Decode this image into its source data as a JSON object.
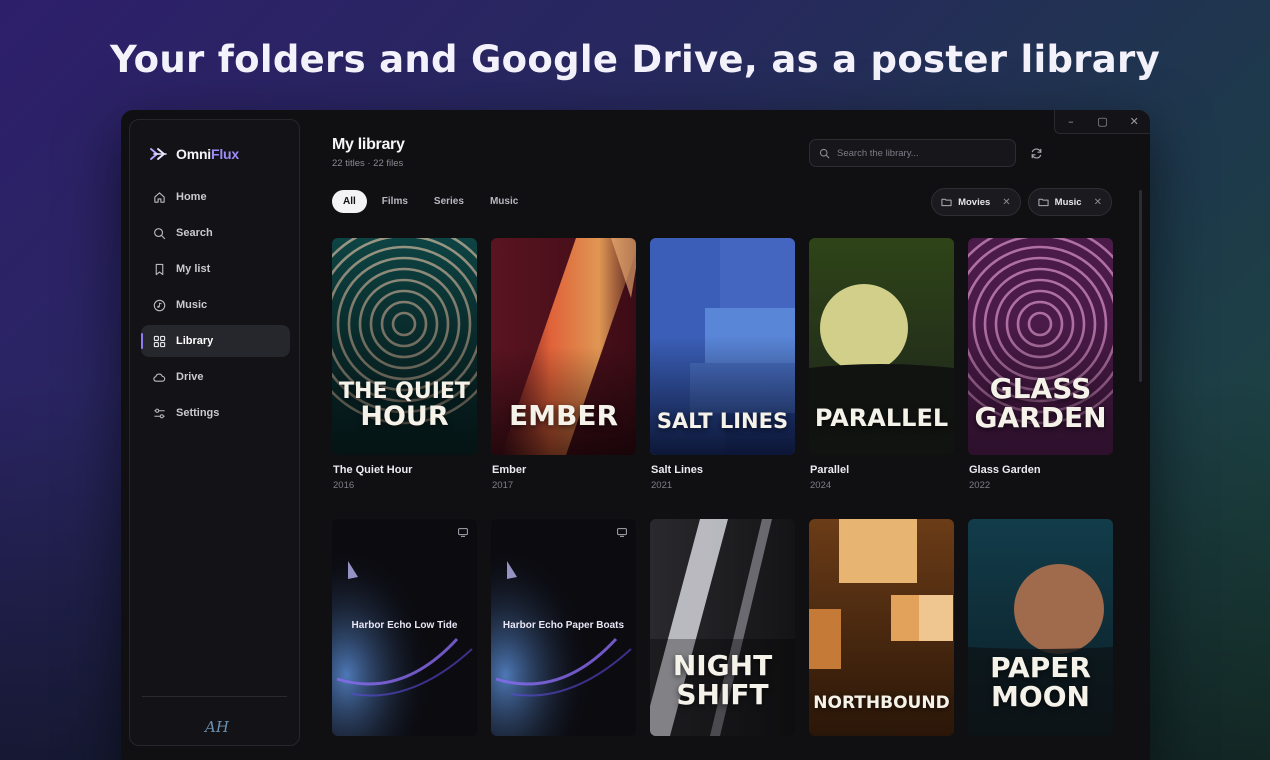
{
  "headline": "Your folders and Google Drive, as a poster library",
  "window": {
    "controls": [
      "–",
      "▢",
      "✕"
    ]
  },
  "brand": {
    "name_a": "Omni",
    "name_b": "Flux",
    "accent": "#9d8cf7"
  },
  "sidebar": {
    "items": [
      {
        "label": "Home",
        "icon": "home-icon"
      },
      {
        "label": "Search",
        "icon": "search-icon"
      },
      {
        "label": "My list",
        "icon": "bookmark-icon"
      },
      {
        "label": "Music",
        "icon": "music-icon"
      },
      {
        "label": "Library",
        "icon": "grid-icon",
        "active": true
      },
      {
        "label": "Drive",
        "icon": "cloud-icon"
      },
      {
        "label": "Settings",
        "icon": "sliders-icon"
      }
    ],
    "footer_logo": "AH"
  },
  "library": {
    "title": "My library",
    "subtitle": "22 titles · 22 files",
    "search_placeholder": "Search the library...",
    "tabs": [
      "All",
      "Films",
      "Series",
      "Music"
    ],
    "active_tab": "All",
    "folder_chips": [
      "Movies",
      "Music"
    ]
  },
  "cards": [
    {
      "title": "The Quiet Hour",
      "year": "2016",
      "poster_text": [
        "THE QUIET",
        "HOUR"
      ]
    },
    {
      "title": "Ember",
      "year": "2017",
      "poster_text": [
        "EMBER"
      ]
    },
    {
      "title": "Salt Lines",
      "year": "2021",
      "poster_text": [
        "SALT LINES"
      ]
    },
    {
      "title": "Parallel",
      "year": "2024",
      "poster_text": [
        "PARALLEL"
      ]
    },
    {
      "title": "Glass Garden",
      "year": "2022",
      "poster_text": [
        "GLASS",
        "GARDEN"
      ]
    },
    {
      "cover_caption": "Harbor Echo Low Tide",
      "icon": "tv-icon"
    },
    {
      "cover_caption": "Harbor Echo Paper Boats",
      "icon": "tv-icon"
    },
    {
      "poster_text": [
        "NIGHT",
        "SHIFT"
      ]
    },
    {
      "poster_text": [
        "NORTHBOUND"
      ]
    },
    {
      "poster_text": [
        "PAPER",
        "MOON"
      ]
    }
  ]
}
